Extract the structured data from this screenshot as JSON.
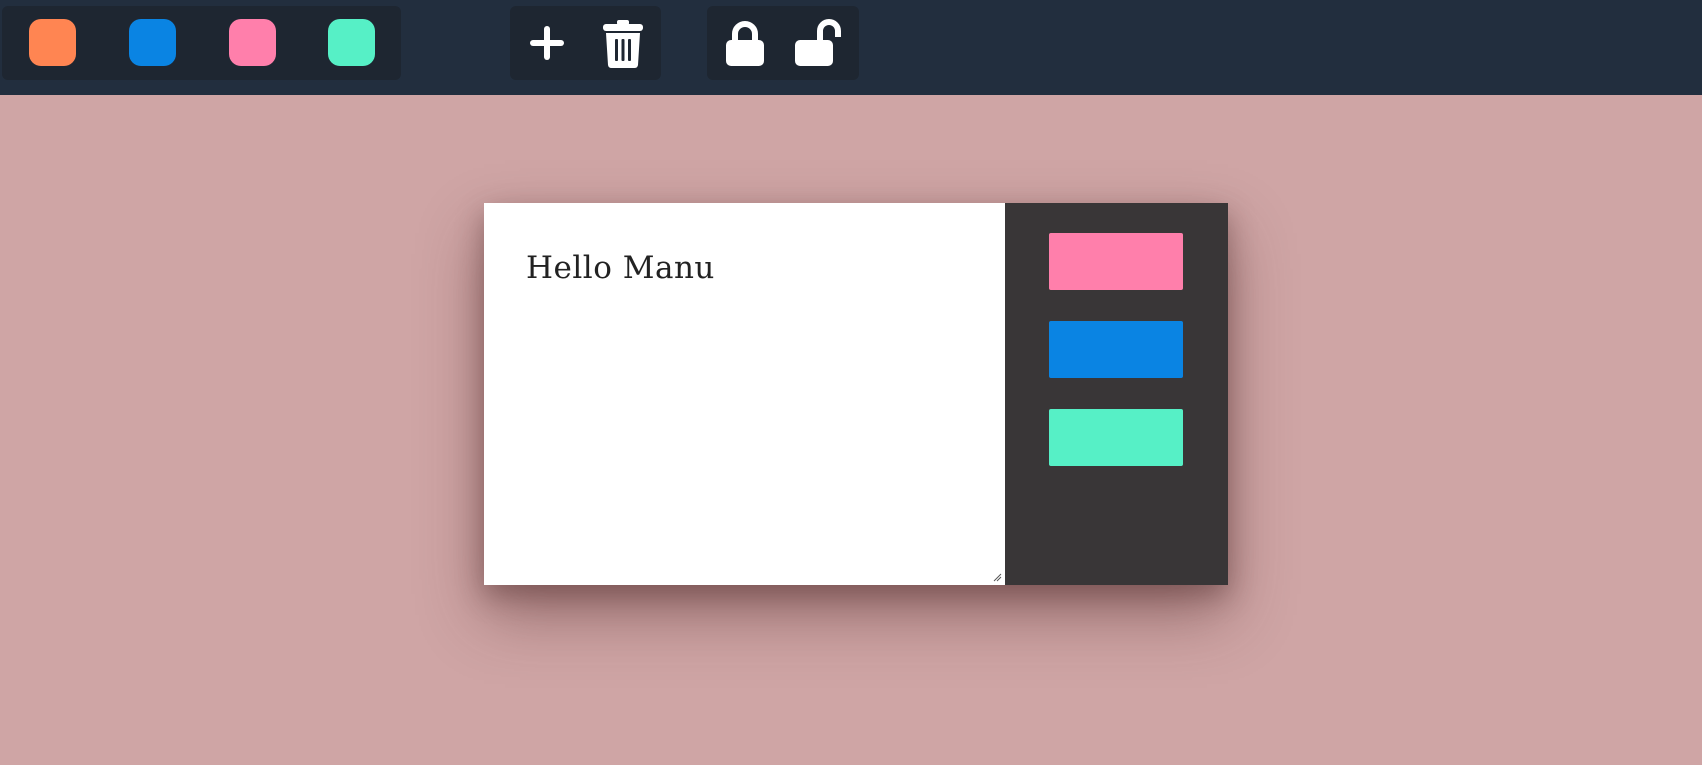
{
  "colors": {
    "page_background": "#cfa5a5",
    "toolbar_background": "#222e3e",
    "toolbar_group_background": "#1e2631",
    "icon_color": "#ffffff",
    "note_sidebar_background": "#393637"
  },
  "toolbar": {
    "color_swatches": [
      {
        "name": "orange",
        "color": "#ff8552"
      },
      {
        "name": "blue",
        "color": "#0a84e3"
      },
      {
        "name": "pink",
        "color": "#ff7fab"
      },
      {
        "name": "mint",
        "color": "#56f0c6"
      }
    ],
    "edit_icons": [
      "plus-icon",
      "trash-icon"
    ],
    "lock_icons": [
      "lock-icon",
      "unlock-icon"
    ]
  },
  "note": {
    "text": "Hello Manu",
    "color_options": [
      {
        "name": "pink",
        "color": "#ff7fab"
      },
      {
        "name": "blue",
        "color": "#0a84e3"
      },
      {
        "name": "mint",
        "color": "#56f0c6"
      }
    ]
  }
}
